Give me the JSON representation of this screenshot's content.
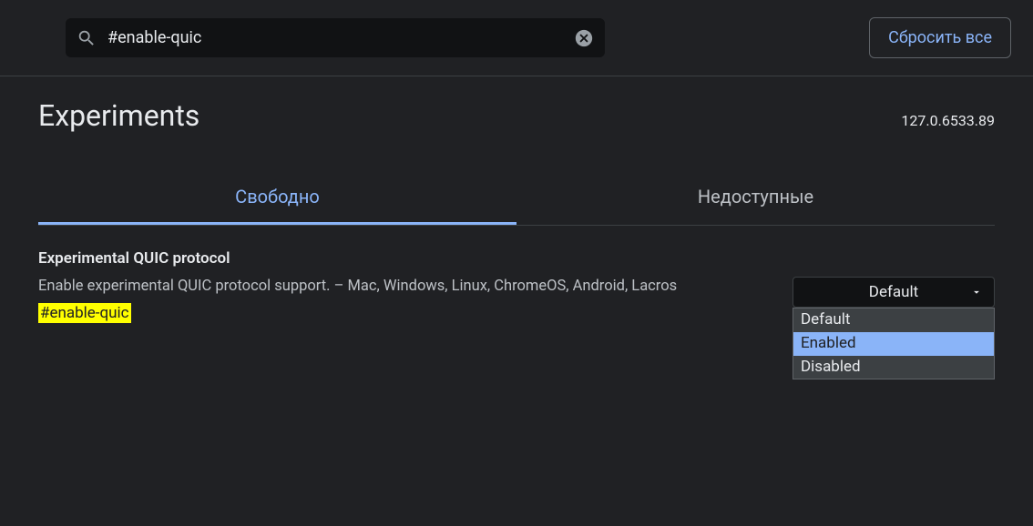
{
  "search": {
    "value": "#enable-quic"
  },
  "reset_button": "Сбросить все",
  "page_title": "Experiments",
  "version": "127.0.6533.89",
  "tabs": {
    "available": "Свободно",
    "unavailable": "Недоступные"
  },
  "flag": {
    "title": "Experimental QUIC protocol",
    "description": "Enable experimental QUIC protocol support. – Mac, Windows, Linux, ChromeOS, Android, Lacros",
    "id_hash": "#enable-quic",
    "selected": "Default",
    "options": [
      "Default",
      "Enabled",
      "Disabled"
    ],
    "hovered_option_index": 1
  }
}
